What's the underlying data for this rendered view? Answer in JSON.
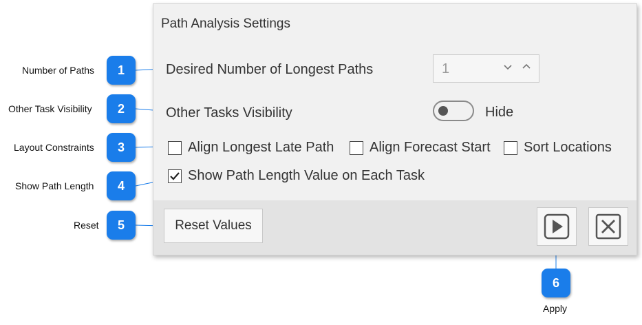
{
  "dialog": {
    "title": "Path Analysis Settings",
    "desired_paths_label": "Desired Number of Longest Paths",
    "desired_paths_value": "1",
    "other_tasks_label": "Other Tasks Visibility",
    "toggle_state_label": "Hide",
    "toggle_on": false,
    "checkboxes": [
      {
        "label": "Align Longest Late Path",
        "checked": false
      },
      {
        "label": "Align Forecast Start",
        "checked": false
      },
      {
        "label": "Sort Locations",
        "checked": false
      },
      {
        "label": "Show Path Length Value on Each Task",
        "checked": true
      }
    ],
    "reset_label": "Reset Values",
    "apply_icon": "play-icon",
    "close_icon": "close-icon"
  },
  "callouts": [
    {
      "number": "1",
      "text": "Number of Paths"
    },
    {
      "number": "2",
      "text": "Other Task Visibility"
    },
    {
      "number": "3",
      "text": "Layout Constraints"
    },
    {
      "number": "4",
      "text": "Show Path Length"
    },
    {
      "number": "5",
      "text": "Reset"
    },
    {
      "number": "6",
      "text": "Apply"
    }
  ],
  "colors": {
    "badge": "#1a7dea",
    "dialog_bg": "#f1f1f1",
    "footer_bg": "#e3e3e3"
  }
}
